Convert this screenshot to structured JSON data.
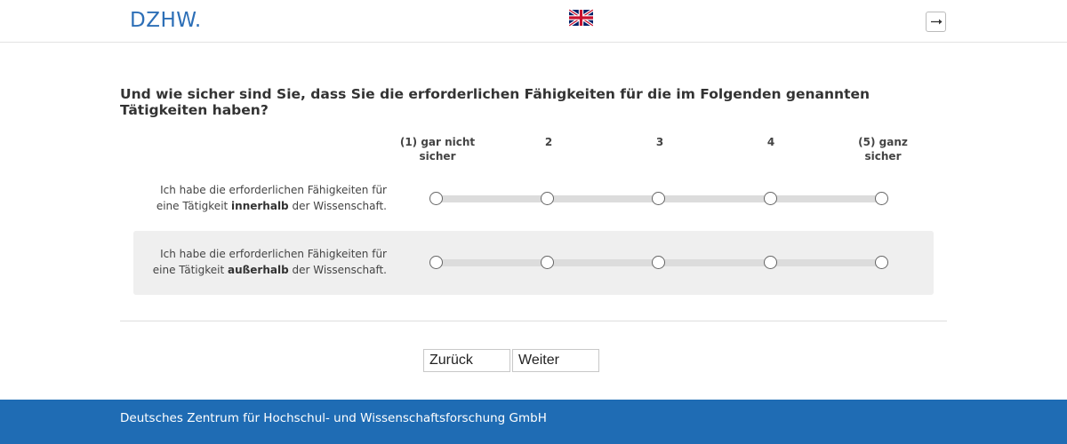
{
  "header": {
    "logo_text": "DZHW.",
    "language_flag_icon": "uk-flag-icon",
    "exit_icon": "exit-arrow-icon"
  },
  "question": {
    "text": "Und wie sicher sind Sie, dass Sie die erforderlichen Fähigkeiten für die im Folgenden genannten Tätigkeiten haben?"
  },
  "scale": {
    "columns": [
      "(1) gar nicht sicher",
      "2",
      "3",
      "4",
      "(5) ganz sicher"
    ]
  },
  "items": [
    {
      "label_pre": "Ich habe die erforderlichen Fähigkeiten für eine Tätigkeit ",
      "label_bold": "innerhalb",
      "label_post": " der Wissenschaft.",
      "selected": null
    },
    {
      "label_pre": "Ich habe die erforderlichen Fähigkeiten für eine Tätigkeit ",
      "label_bold": "außerhalb",
      "label_post": " der Wissenschaft.",
      "selected": null
    }
  ],
  "navigation": {
    "back_label": "Zurück",
    "next_label": "Weiter"
  },
  "footer": {
    "text": "Deutsches Zentrum für Hochschul- und Wissenschaftsforschung GmbH"
  },
  "colors": {
    "brand_blue": "#1f6cb4",
    "logo_blue": "#2d6fb7",
    "row_highlight": "#efefef"
  }
}
